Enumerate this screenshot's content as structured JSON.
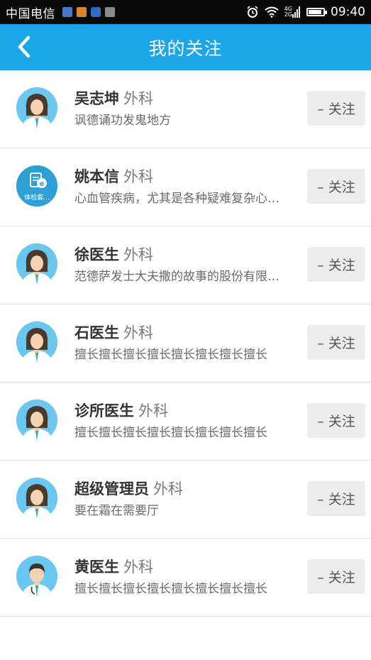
{
  "status_bar": {
    "carrier": "中国电信",
    "time": "09:40",
    "network_top": "4G",
    "network_bottom": "2G",
    "icons": [
      "alarm-icon",
      "wifi-icon",
      "signal-icon",
      "battery-icon"
    ]
  },
  "header": {
    "title": "我的关注",
    "back_icon": "chevron-left-icon",
    "color": "#1aa6e8"
  },
  "doctors": [
    {
      "name": "吴志坤",
      "dept": "外科",
      "desc": "讽德诵功发鬼地方",
      "button": "– 关注",
      "avatar": "female-doctor-avatar"
    },
    {
      "name": "姚本信",
      "dept": "外科",
      "desc": "心血管疾病，尤其是各种疑难复杂心血管疾病",
      "button": "– 关注",
      "avatar": "exam-avatar",
      "avatar_label": "体检套..."
    },
    {
      "name": "徐医生",
      "dept": "外科",
      "desc": "范德萨发士大夫撒的故事的股份有限公司",
      "button": "– 关注",
      "avatar": "female-doctor-avatar"
    },
    {
      "name": "石医生",
      "dept": "外科",
      "desc": "擅长擅长擅长擅长擅长擅长擅长擅长",
      "button": "– 关注",
      "avatar": "female-doctor-avatar"
    },
    {
      "name": "诊所医生",
      "dept": "外科",
      "desc": "擅长擅长擅长擅长擅长擅长擅长擅长",
      "button": "– 关注",
      "avatar": "female-doctor-avatar"
    },
    {
      "name": "超级管理员",
      "dept": "外科",
      "desc": "要在霜在需要厅",
      "button": "– 关注",
      "avatar": "female-doctor-avatar"
    },
    {
      "name": "黄医生",
      "dept": "外科",
      "desc": "擅长擅长擅长擅长擅长擅长擅长擅长",
      "button": "– 关注",
      "avatar": "male-doctor-avatar"
    }
  ]
}
